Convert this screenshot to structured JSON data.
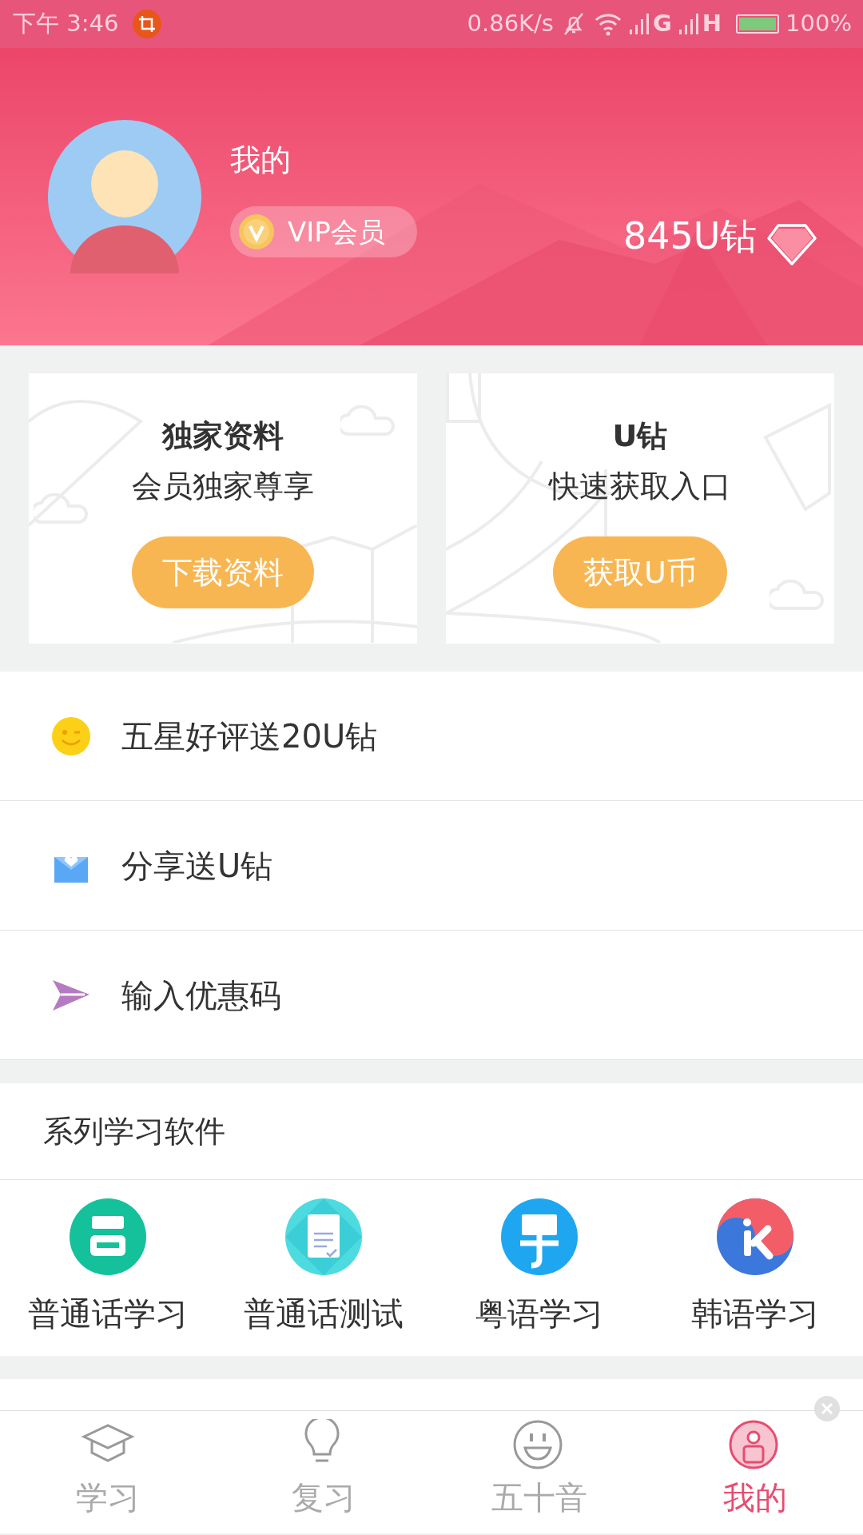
{
  "status_bar": {
    "time": "下午 3:46",
    "speed": "0.86K/s",
    "networks": [
      "G",
      "H"
    ],
    "battery": "100%"
  },
  "profile": {
    "name": "我的",
    "badge": "VIP会员",
    "balance": "845U钻"
  },
  "cards": [
    {
      "title": "独家资料",
      "subtitle": "会员独家尊享",
      "button": "下载资料"
    },
    {
      "title": "U钻",
      "subtitle": "快速获取入口",
      "button": "获取U币"
    }
  ],
  "menu": [
    {
      "kind": "smile",
      "label": "五星好评送20U钻"
    },
    {
      "kind": "share",
      "label": "分享送U钻"
    },
    {
      "kind": "send",
      "label": "输入优惠码"
    }
  ],
  "section_title": "系列学习软件",
  "apps": [
    {
      "kind": "putonghua",
      "label": "普通话学习"
    },
    {
      "kind": "test",
      "label": "普通话测试"
    },
    {
      "kind": "cantonese",
      "label": "粤语学习"
    },
    {
      "kind": "korean",
      "label": "韩语学习"
    }
  ],
  "tabs": [
    {
      "kind": "study",
      "label": "学习",
      "selected": false
    },
    {
      "kind": "review",
      "label": "复习",
      "selected": false
    },
    {
      "kind": "kana",
      "label": "五十音",
      "selected": false
    },
    {
      "kind": "me",
      "label": "我的",
      "selected": true
    }
  ]
}
